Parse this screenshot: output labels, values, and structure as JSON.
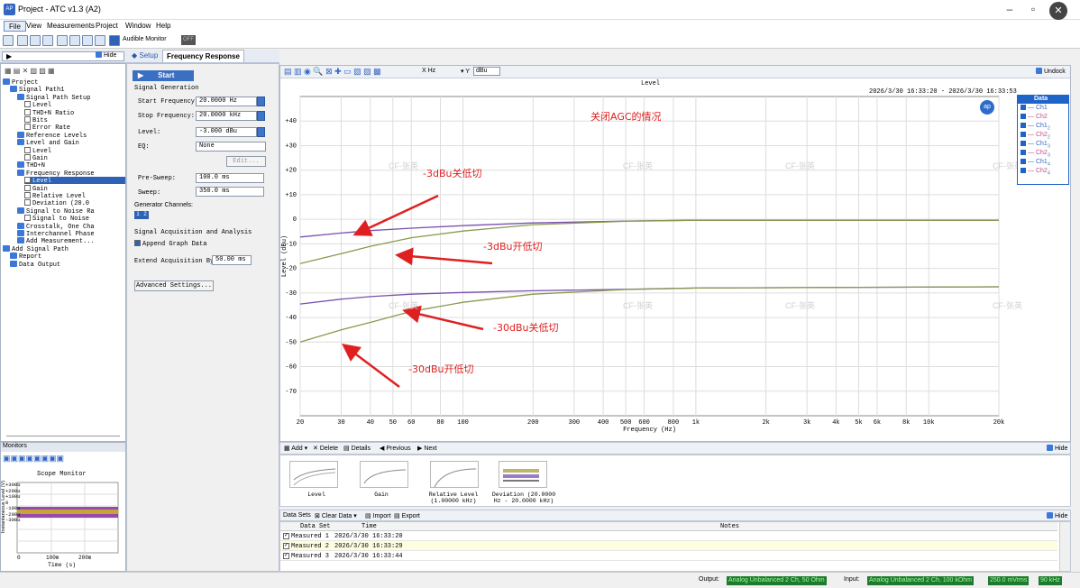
{
  "window": {
    "title": "Project - ATC v1.3 (A2)"
  },
  "menu": [
    "File",
    "View",
    "Measurements",
    "Project",
    "Window",
    "Help"
  ],
  "toolbar": {
    "audible_monitor": "Audible Monitor",
    "toggle": "OFF"
  },
  "nav": {
    "hide": "Hide",
    "setup": "Setup",
    "tab": "Frequency Response"
  },
  "tree": [
    {
      "t": "Project",
      "d": 0
    },
    {
      "t": "Signal Path1",
      "d": 1
    },
    {
      "t": "Signal Path Setup",
      "d": 2
    },
    {
      "t": "Level",
      "d": 3
    },
    {
      "t": "THD+N Ratio",
      "d": 3
    },
    {
      "t": "Bits",
      "d": 3
    },
    {
      "t": "Error Rate",
      "d": 3
    },
    {
      "t": "Reference Levels",
      "d": 2
    },
    {
      "t": "Level and Gain",
      "d": 2
    },
    {
      "t": "Level",
      "d": 3
    },
    {
      "t": "Gain",
      "d": 3
    },
    {
      "t": "THD+N",
      "d": 2
    },
    {
      "t": "Frequency Response",
      "d": 2
    },
    {
      "t": "Level",
      "d": 3,
      "sel": true
    },
    {
      "t": "Gain",
      "d": 3
    },
    {
      "t": "Relative Level",
      "d": 3
    },
    {
      "t": "Deviation (20.0",
      "d": 3
    },
    {
      "t": "Signal to Noise Ra",
      "d": 2
    },
    {
      "t": "Signal to Noise",
      "d": 3
    },
    {
      "t": "Crosstalk, One Cha",
      "d": 2
    },
    {
      "t": "Interchannel Phase",
      "d": 2
    },
    {
      "t": "Add Measurement...",
      "d": 2
    },
    {
      "t": "Add Signal Path",
      "d": 0
    },
    {
      "t": "Report",
      "d": 1
    },
    {
      "t": "Data Output",
      "d": 1
    }
  ],
  "setup": {
    "start": "Start",
    "signal_generation": "Signal Generation",
    "start_freq_label": "Start Frequency:",
    "start_freq": "20.0000 Hz",
    "stop_freq_label": "Stop Frequency:",
    "stop_freq": "20.0000 kHz",
    "level_label": "Level:",
    "level": "-3.000 dBu",
    "eq_label": "EQ:",
    "eq": "None",
    "edit": "Edit...",
    "presweep_label": "Pre-Sweep:",
    "presweep": "100.0 ms",
    "sweep_label": "Sweep:",
    "sweep": "350.0 ms",
    "gen_channels": "Generator Channels:",
    "ch": [
      "1",
      "2"
    ],
    "acq_title": "Signal Acquisition and Analysis",
    "append": "Append Graph Data",
    "extend_label": "Extend Acquisition By:",
    "extend": "50.00 ms",
    "advanced": "Advanced Settings..."
  },
  "monitors": {
    "title": "Monitors",
    "scope": "Scope Monitor",
    "xlabel": "Time (s)",
    "ylabel": "Instantaneous Level (V)",
    "yticks": [
      "+300u",
      "+200u",
      "+100u",
      "0",
      "-100u",
      "-200u",
      "-300u"
    ],
    "xticks": [
      "0",
      "100m",
      "200m"
    ]
  },
  "graph": {
    "undock": "Undock",
    "unit_x": "Hz",
    "unit_y": "dBu",
    "title": "Level",
    "time_range": "2026/3/30 16:33:20 - 2026/3/30 16:33:53",
    "annot_main": "关闭AGC的情况",
    "annot1": "-3dBu关低切",
    "annot2": "-3dBu开低切",
    "annot3": "-30dBu关低切",
    "annot4": "-30dBu开低切",
    "watermark": "CF-张英"
  },
  "chart_data": {
    "type": "line",
    "title": "Level",
    "xlabel": "Frequency (Hz)",
    "ylabel": "Level (dBu)",
    "xscale": "log",
    "xlim": [
      20,
      20000
    ],
    "ylim": [
      -80,
      50
    ],
    "xticks": [
      "20",
      "30",
      "40",
      "50",
      "60",
      "80",
      "100",
      "200",
      "300",
      "400",
      "500",
      "600",
      "800",
      "1k",
      "2k",
      "3k",
      "4k",
      "5k",
      "6k",
      "8k",
      "10k",
      "20k"
    ],
    "yticks": [
      "+40",
      "+30",
      "+20",
      "+10",
      "0",
      "-10",
      "-20",
      "-30",
      "-40",
      "-50",
      "-60",
      "-70"
    ],
    "x": [
      20,
      30,
      40,
      60,
      100,
      200,
      500,
      1000,
      20000
    ],
    "series": [
      {
        "color": "#7b4fb0",
        "values": [
          -7.2,
          -5.6,
          -4.6,
          -3.6,
          -2.6,
          -1.5,
          -0.7,
          -0.4,
          -0.4
        ]
      },
      {
        "color": "#8a9a4c",
        "values": [
          -18.0,
          -14.0,
          -11.0,
          -7.5,
          -4.8,
          -2.2,
          -0.8,
          -0.4,
          -0.4
        ]
      },
      {
        "color": "#7b4fb0",
        "values": [
          -34.5,
          -32.5,
          -31.5,
          -30.5,
          -29.8,
          -29.1,
          -28.5,
          -28.0,
          -27.5
        ]
      },
      {
        "color": "#8a9a4c",
        "values": [
          -50.0,
          -45.0,
          -42.0,
          -37.5,
          -33.8,
          -30.5,
          -28.6,
          -28.0,
          -27.5
        ]
      }
    ]
  },
  "legend": {
    "title": "Data",
    "items": [
      {
        "name": "Ch1",
        "sub": ""
      },
      {
        "name": "Ch2",
        "sub": ""
      },
      {
        "name": "Ch1",
        "sub": "2"
      },
      {
        "name": "Ch2",
        "sub": "2"
      },
      {
        "name": "Ch1",
        "sub": "3"
      },
      {
        "name": "Ch2",
        "sub": "3"
      },
      {
        "name": "Ch1",
        "sub": "4"
      },
      {
        "name": "Ch2",
        "sub": "4"
      }
    ]
  },
  "results": {
    "add": "Add",
    "delete": "Delete",
    "details": "Details",
    "previous": "Previous",
    "next": "Next",
    "hide": "Hide",
    "thumbs": [
      "Level",
      "Gain",
      "Relative Level\n(1.00000 kHz)",
      "Deviation (20.0000\nHz - 20.0000 kHz)"
    ]
  },
  "datasets": {
    "label": "Data Sets",
    "clear": "Clear Data",
    "import": "Import",
    "export": "Export",
    "hide": "Hide",
    "headers": [
      "Data Set",
      "Time",
      "Notes"
    ],
    "rows": [
      [
        "Measured 1",
        "2026/3/30 16:33:20"
      ],
      [
        "Measured 2",
        "2026/3/30 16:33:29"
      ],
      [
        "Measured 3",
        "2026/3/30 16:33:44"
      ]
    ]
  },
  "status": {
    "output_label": "Output:",
    "output": "Analog Unbalanced 2 Ch, 50 Ohm",
    "input_label": "Input:",
    "input": "Analog Unbalanced 2 Ch, 100 kOhm",
    "vrms": "250.0 mVrms",
    "hz": "90 kHz"
  }
}
